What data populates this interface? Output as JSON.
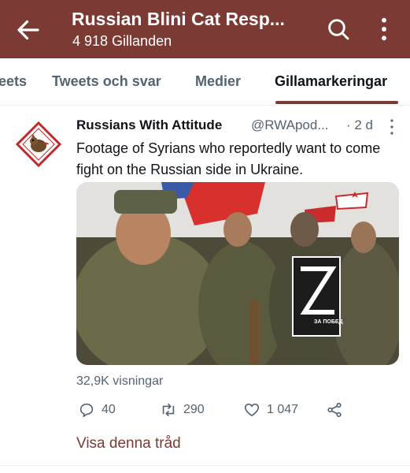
{
  "header": {
    "title": "Russian Blini Cat Resp...",
    "subtitle": "4 918 Gillanden"
  },
  "tabs": [
    {
      "label": "eets"
    },
    {
      "label": "Tweets och svar"
    },
    {
      "label": "Medier"
    },
    {
      "label": "Gillamarkeringar",
      "active": true
    }
  ],
  "tweet": {
    "author_name": "Russians With Attitude",
    "author_handle": "@RWApod...",
    "time": "· 2 d",
    "text": "Footage of Syrians who reportedly want to come fight on the Russian side in Ukraine.",
    "media_caption": "ЗА ПОБЕД",
    "views": "32,9K visningar",
    "replies": "40",
    "retweets": "290",
    "likes": "1 047",
    "thread_link": "Visa denna tråd"
  },
  "colors": {
    "header_bg": "#7b3a33",
    "text_primary": "#0f1419",
    "text_secondary": "#536471",
    "accent": "#7b3a33"
  },
  "icons": {
    "back": "arrow-left-icon",
    "search": "search-icon",
    "more": "more-vertical-icon",
    "reply": "reply-icon",
    "retweet": "retweet-icon",
    "like": "heart-icon",
    "share": "share-icon"
  }
}
